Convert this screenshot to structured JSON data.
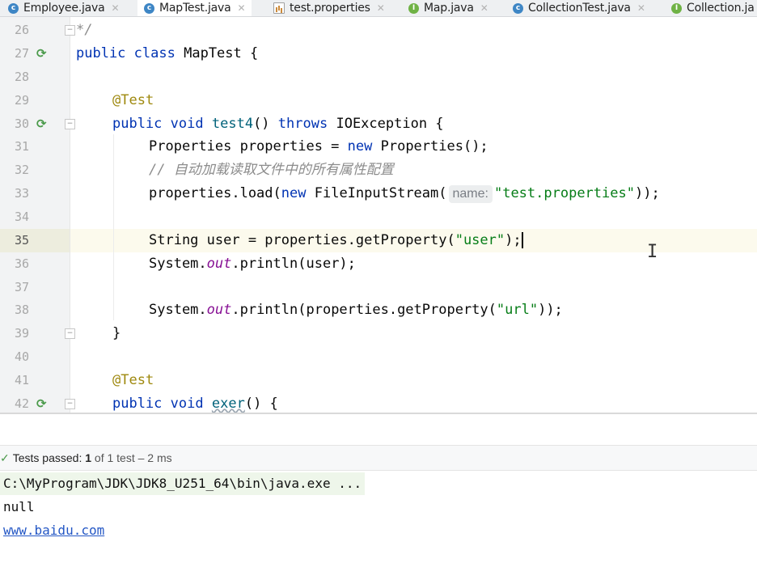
{
  "tabs": [
    {
      "icon": "class-icon",
      "label": "Employee.java",
      "active": false
    },
    {
      "icon": "class-icon",
      "label": "MapTest.java",
      "active": true
    },
    {
      "icon": "properties-file-icon",
      "label": "test.properties",
      "active": false
    },
    {
      "icon": "interface-icon",
      "label": "Map.java",
      "active": false
    },
    {
      "icon": "class-icon",
      "label": "CollectionTest.java",
      "active": false
    },
    {
      "icon": "interface-icon",
      "label": "Collection.ja",
      "active": false
    }
  ],
  "editor": {
    "current_line": "35",
    "line_numbers": [
      "26",
      "27",
      "28",
      "29",
      "30",
      "31",
      "32",
      "33",
      "34",
      "35",
      "36",
      "37",
      "38",
      "39",
      "40",
      "41",
      "42"
    ],
    "lines": {
      "l26": {
        "t1": "*/"
      },
      "l27": {
        "kw1": "public",
        "kw2": "class",
        "t1": "MapTest {"
      },
      "l29": {
        "ann": "@Test"
      },
      "l30": {
        "kw1": "public",
        "kw2": "void",
        "name": "test4",
        "t1": "()",
        "kw3": "throws",
        "t2": "IOException {"
      },
      "l31": {
        "t1": "Properties properties = ",
        "kw1": "new",
        "t2": "Properties();"
      },
      "l32": {
        "cmt": "// ",
        "cmt_cjk": "自动加载读取文件中的所有属性配置"
      },
      "l33": {
        "t1": "properties.load(",
        "kw1": "new",
        "t2": "FileInputStream(",
        "hint": "name:",
        "str": "\"test.properties\"",
        "t3": "));"
      },
      "l35": {
        "t1": "String user = properties.getProperty(",
        "str": "\"user\"",
        "t2": ");"
      },
      "l36": {
        "t1": "System.",
        "fld": "out",
        "t2": ".println(user);"
      },
      "l38": {
        "t1": "System.",
        "fld": "out",
        "t2": ".println(properties.getProperty(",
        "str": "\"url\"",
        "t3": "));"
      },
      "l39": {
        "t1": "}"
      },
      "l41": {
        "ann": "@Test"
      },
      "l42": {
        "kw1": "public",
        "kw2": "void",
        "name": "exer",
        "t1": "() {"
      }
    }
  },
  "run": {
    "status_prefix": "Tests passed:",
    "passed_count": "1",
    "status_suffix": "of 1 test – 2 ms",
    "console": {
      "command": "C:\\MyProgram\\JDK\\JDK8_U251_64\\bin\\java.exe ...",
      "out1": "null",
      "out2": "www.baidu.com"
    }
  },
  "colors": {
    "keyword": "#0033b3",
    "annotation": "#9e880d",
    "string": "#067d17",
    "comment": "#8c8c8c",
    "field": "#871094",
    "link": "#2457c5"
  }
}
